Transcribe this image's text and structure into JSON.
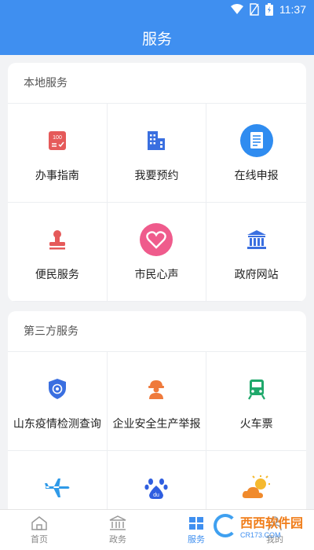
{
  "status_bar": {
    "time": "11:37"
  },
  "header": {
    "title": "服务"
  },
  "sections": [
    {
      "title": "本地服务",
      "items": [
        {
          "label": "办事指南",
          "icon": "guide-badge-icon"
        },
        {
          "label": "我要预约",
          "icon": "buildings-icon"
        },
        {
          "label": "在线申报",
          "icon": "document-icon"
        },
        {
          "label": "便民服务",
          "icon": "stamp-icon"
        },
        {
          "label": "市民心声",
          "icon": "heart-icon"
        },
        {
          "label": "政府网站",
          "icon": "government-building-icon"
        }
      ]
    },
    {
      "title": "第三方服务",
      "items": [
        {
          "label": "山东疫情检测查询",
          "icon": "shield-icon"
        },
        {
          "label": "企业安全生产举报",
          "icon": "worker-helmet-icon"
        },
        {
          "label": "火车票",
          "icon": "train-icon"
        },
        {
          "label": "",
          "icon": "airplane-icon"
        },
        {
          "label": "",
          "icon": "baidu-paw-icon"
        },
        {
          "label": "",
          "icon": "weather-sun-cloud-icon"
        }
      ]
    }
  ],
  "tabbar": [
    {
      "label": "首页",
      "icon": "home-icon"
    },
    {
      "label": "政务",
      "icon": "government-icon"
    },
    {
      "label": "服务",
      "icon": "service-icon",
      "active": true
    },
    {
      "label": "我的",
      "icon": "profile-icon"
    }
  ],
  "watermark": {
    "main": "西西软件园",
    "sub": "CR173.COM"
  },
  "colors": {
    "primary": "#3f8ff0",
    "page_bg": "#f2f3f5"
  }
}
